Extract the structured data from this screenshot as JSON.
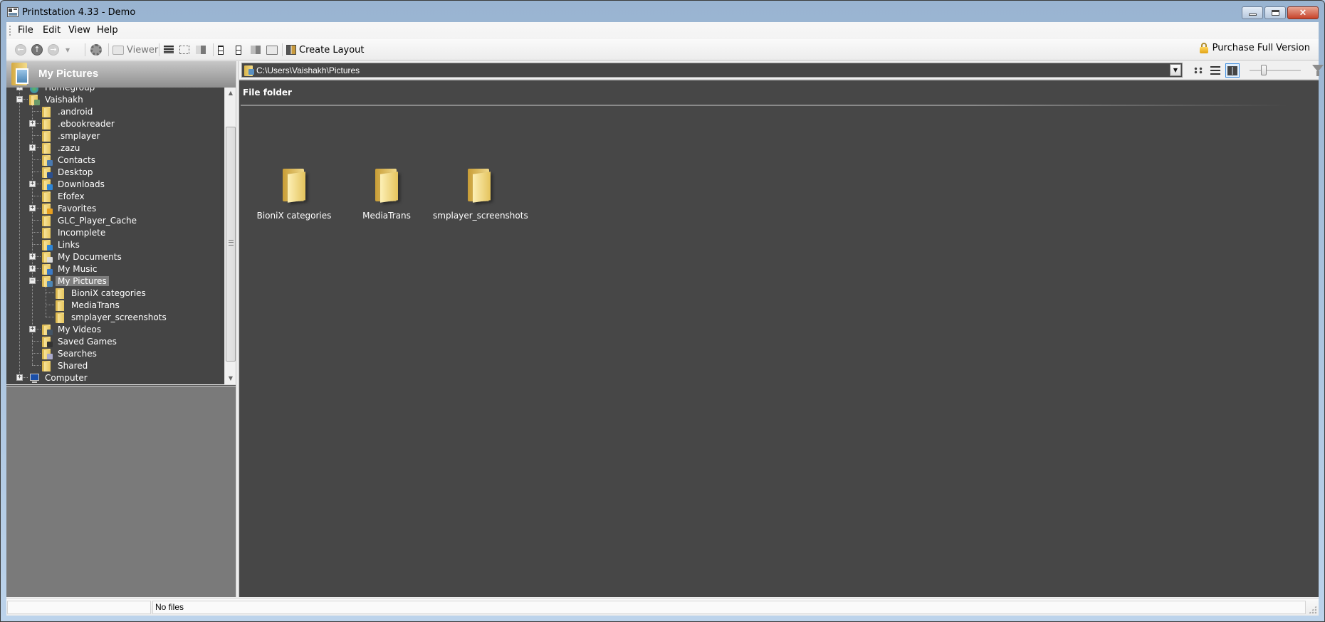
{
  "window": {
    "title": "Printstation 4.33 - Demo",
    "controls": {
      "minimize": "minimize",
      "maximize": "maximize",
      "close": "×"
    }
  },
  "menu": [
    "File",
    "Edit",
    "View",
    "Help"
  ],
  "toolbar": {
    "back_icon": "←",
    "up_icon": "↑",
    "forward_icon": "→",
    "dropdown_icon": "▾",
    "viewer_label": "Viewer",
    "create_layout_label": "Create Layout",
    "purchase_label": "Purchase Full Version"
  },
  "left_panel": {
    "title": "My Pictures",
    "tree": [
      {
        "label": "Homegroup",
        "level": 0,
        "expander": "+",
        "icon": "homegroup-icon",
        "partial": true
      },
      {
        "label": "Vaishakh",
        "level": 0,
        "expander": "−",
        "icon": "user-folder-icon"
      },
      {
        "label": ".android",
        "level": 1,
        "expander": "",
        "icon": "folder-icon"
      },
      {
        "label": ".ebookreader",
        "level": 1,
        "expander": "+",
        "icon": "folder-icon"
      },
      {
        "label": ".smplayer",
        "level": 1,
        "expander": "",
        "icon": "folder-icon"
      },
      {
        "label": ".zazu",
        "level": 1,
        "expander": "+",
        "icon": "folder-icon"
      },
      {
        "label": "Contacts",
        "level": 1,
        "expander": "",
        "icon": "contacts-folder-icon"
      },
      {
        "label": "Desktop",
        "level": 1,
        "expander": "",
        "icon": "desktop-folder-icon"
      },
      {
        "label": "Downloads",
        "level": 1,
        "expander": "+",
        "icon": "downloads-folder-icon"
      },
      {
        "label": "Efofex",
        "level": 1,
        "expander": "",
        "icon": "folder-icon"
      },
      {
        "label": "Favorites",
        "level": 1,
        "expander": "+",
        "icon": "favorites-folder-icon"
      },
      {
        "label": "GLC_Player_Cache",
        "level": 1,
        "expander": "",
        "icon": "folder-icon"
      },
      {
        "label": "Incomplete",
        "level": 1,
        "expander": "",
        "icon": "folder-icon"
      },
      {
        "label": "Links",
        "level": 1,
        "expander": "",
        "icon": "links-folder-icon"
      },
      {
        "label": "My Documents",
        "level": 1,
        "expander": "+",
        "icon": "documents-folder-icon"
      },
      {
        "label": "My Music",
        "level": 1,
        "expander": "+",
        "icon": "music-folder-icon"
      },
      {
        "label": "My Pictures",
        "level": 1,
        "expander": "−",
        "icon": "pictures-folder-icon",
        "selected": true
      },
      {
        "label": "BioniX categories",
        "level": 2,
        "expander": "",
        "icon": "folder-icon"
      },
      {
        "label": "MediaTrans",
        "level": 2,
        "expander": "",
        "icon": "folder-icon"
      },
      {
        "label": "smplayer_screenshots",
        "level": 2,
        "expander": "",
        "icon": "folder-icon"
      },
      {
        "label": "My Videos",
        "level": 1,
        "expander": "+",
        "icon": "videos-folder-icon"
      },
      {
        "label": "Saved Games",
        "level": 1,
        "expander": "",
        "icon": "saved-games-folder-icon"
      },
      {
        "label": "Searches",
        "level": 1,
        "expander": "",
        "icon": "searches-folder-icon"
      },
      {
        "label": "Shared",
        "level": 1,
        "expander": "",
        "icon": "folder-icon"
      },
      {
        "label": "Computer",
        "level": 0,
        "expander": "+",
        "icon": "computer-icon"
      }
    ]
  },
  "address": {
    "path": "C:\\Users\\Vaishakh\\Pictures",
    "dropdown_icon": "▼"
  },
  "view_controls": {
    "zoom_slider_value": 0.25
  },
  "content": {
    "group_header": "File folder",
    "items": [
      {
        "label": "BioniX categories"
      },
      {
        "label": "MediaTrans"
      },
      {
        "label": "smplayer_screenshots"
      }
    ]
  },
  "status": {
    "left": "",
    "files": "No files"
  },
  "colors": {
    "panel_bg": "#474747",
    "selection": "#7e7e7e",
    "title_gradient_top": "#99b4d1",
    "active_view_border": "#3d8de0"
  }
}
